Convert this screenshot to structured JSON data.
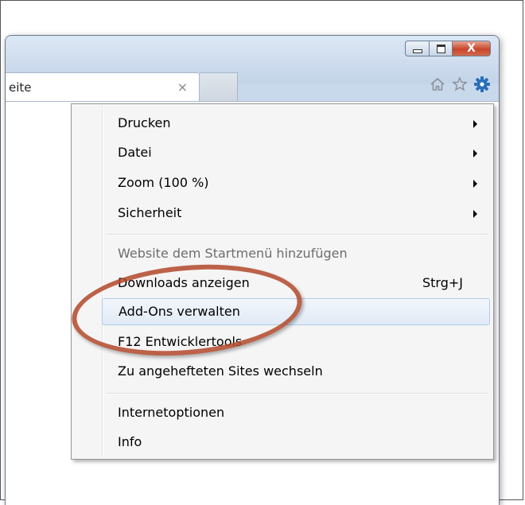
{
  "tab": {
    "title": "eite",
    "close_glyph": "×"
  },
  "window_buttons": {
    "close_glyph": "X"
  },
  "toolbar": {
    "home_icon": "home-icon",
    "favorites_icon": "star-icon",
    "tools_icon": "gear-icon"
  },
  "menu": {
    "items": [
      {
        "label": "Drucken",
        "submenu": true
      },
      {
        "label": "Datei",
        "submenu": true
      },
      {
        "label": "Zoom (100 %)",
        "submenu": true
      },
      {
        "label": "Sicherheit",
        "submenu": true
      },
      {
        "label": "Website dem Startmenü hinzufügen",
        "disabled": true
      },
      {
        "label": "Downloads anzeigen",
        "shortcut": "Strg+J"
      },
      {
        "label": "Add-Ons verwalten",
        "highlighted": true
      },
      {
        "label": "F12 Entwicklertools"
      },
      {
        "label": "Zu angehefteten Sites wechseln"
      },
      {
        "label": "Internetoptionen"
      },
      {
        "label": "Info"
      }
    ]
  },
  "colors": {
    "accent_ring": "#b2482a",
    "gear": "#2a6fba"
  }
}
